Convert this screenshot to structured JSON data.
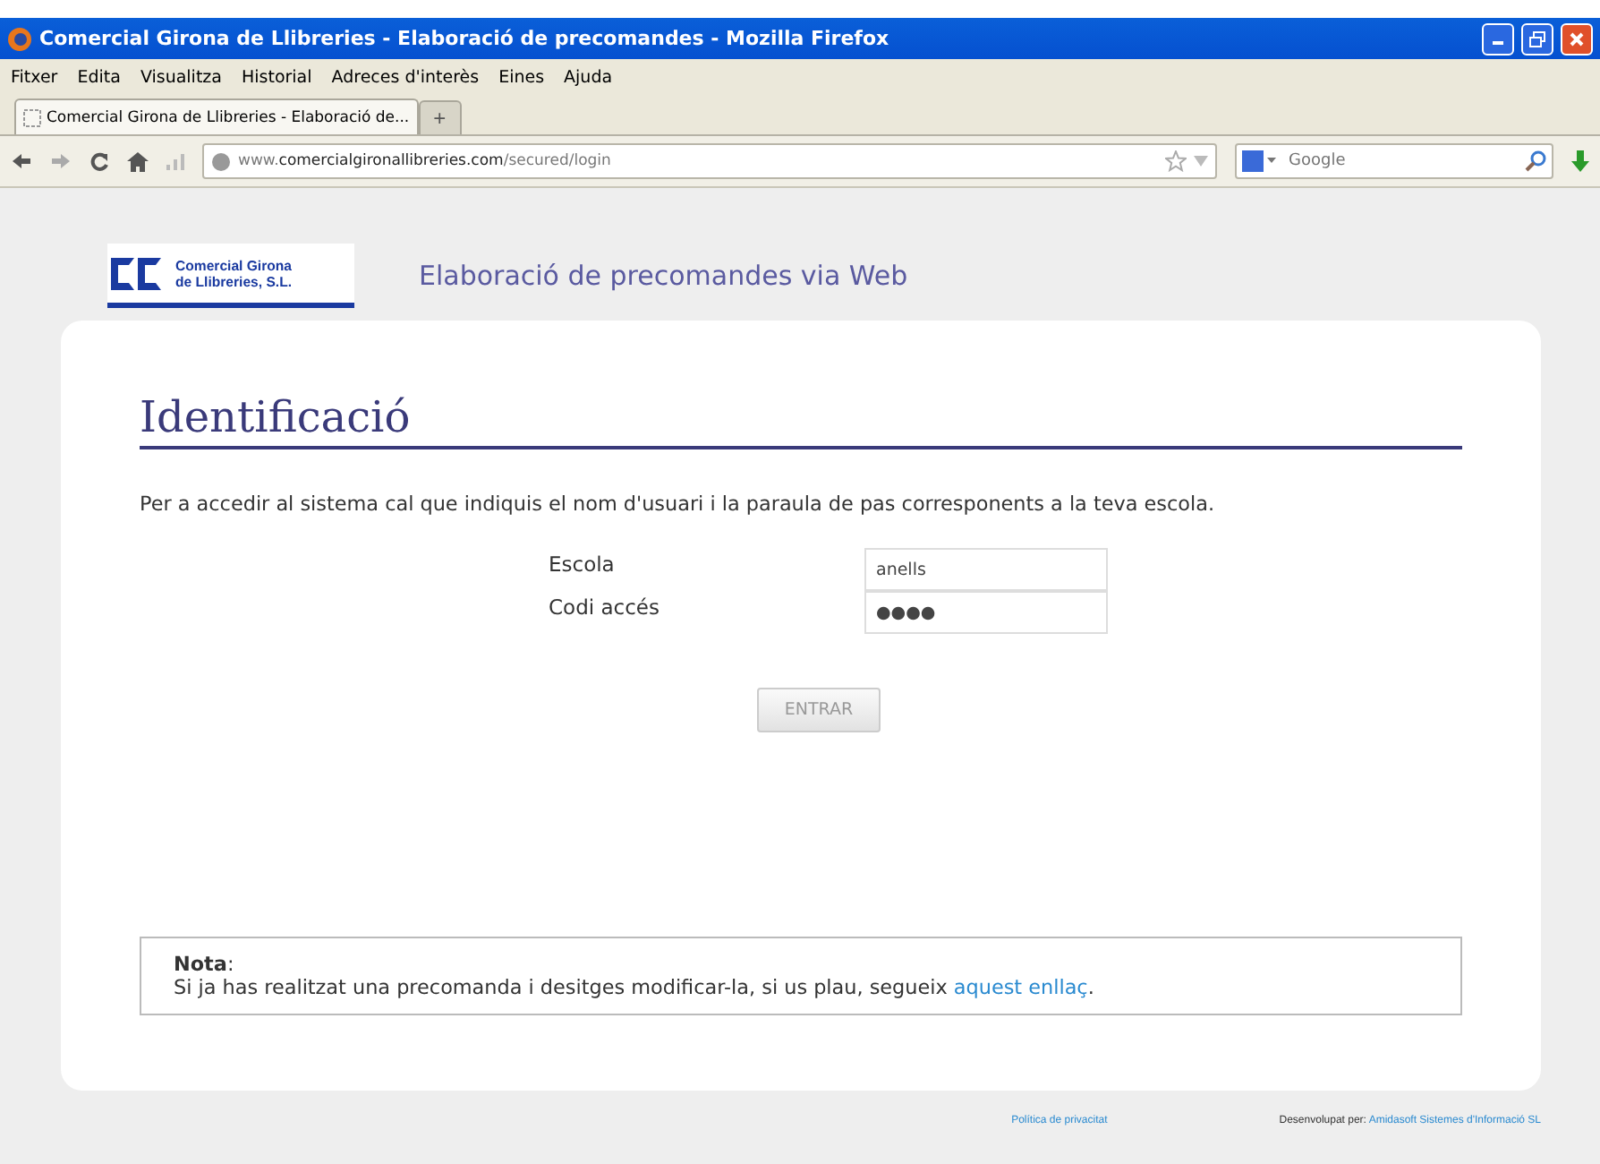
{
  "window": {
    "title": "Comercial Girona de Llibreries - Elaboració de precomandes - Mozilla Firefox"
  },
  "menu": [
    "Fitxer",
    "Edita",
    "Visualitza",
    "Historial",
    "Adreces d'interès",
    "Eines",
    "Ajuda"
  ],
  "tabs": [
    {
      "label": "Comercial Girona de Llibreries - Elaboració de...",
      "selected": true
    }
  ],
  "new_tab": "+",
  "address_bar": {
    "prefix": "www.",
    "domain": "comercialgironallibreries.com",
    "path": "/secured/login"
  },
  "search": {
    "placeholder": "Google"
  },
  "header": {
    "logo_line_1": "Comercial Girona",
    "logo_line_2": "de Llibreries, S.L.",
    "title": "Elaboració de precomandes via Web"
  },
  "login": {
    "heading": "Identificació",
    "intro": "Per a accedir al sistema cal que indiquis el nom d'usuari i la paraula de pas corresponents a la teva escola.",
    "fields": [
      {
        "label": "Escola",
        "value": "anells"
      },
      {
        "label": "Codi accés",
        "value": "●●●●"
      }
    ],
    "button": {
      "label": "ENTRAR",
      "disabled": true
    }
  },
  "note": {
    "title": "**Nota**:",
    "text": "Si ja has realitzat una precomanda i desitges modificar-la, si us plau, segueix ",
    "link": "aquest enllaç",
    "after_link": "."
  },
  "footer": {
    "privacy": "Política de privacitat",
    "credit_label": "Desenvolupat per: ",
    "credit_link": "Amidasoft Sistemes d'Informació SL"
  }
}
